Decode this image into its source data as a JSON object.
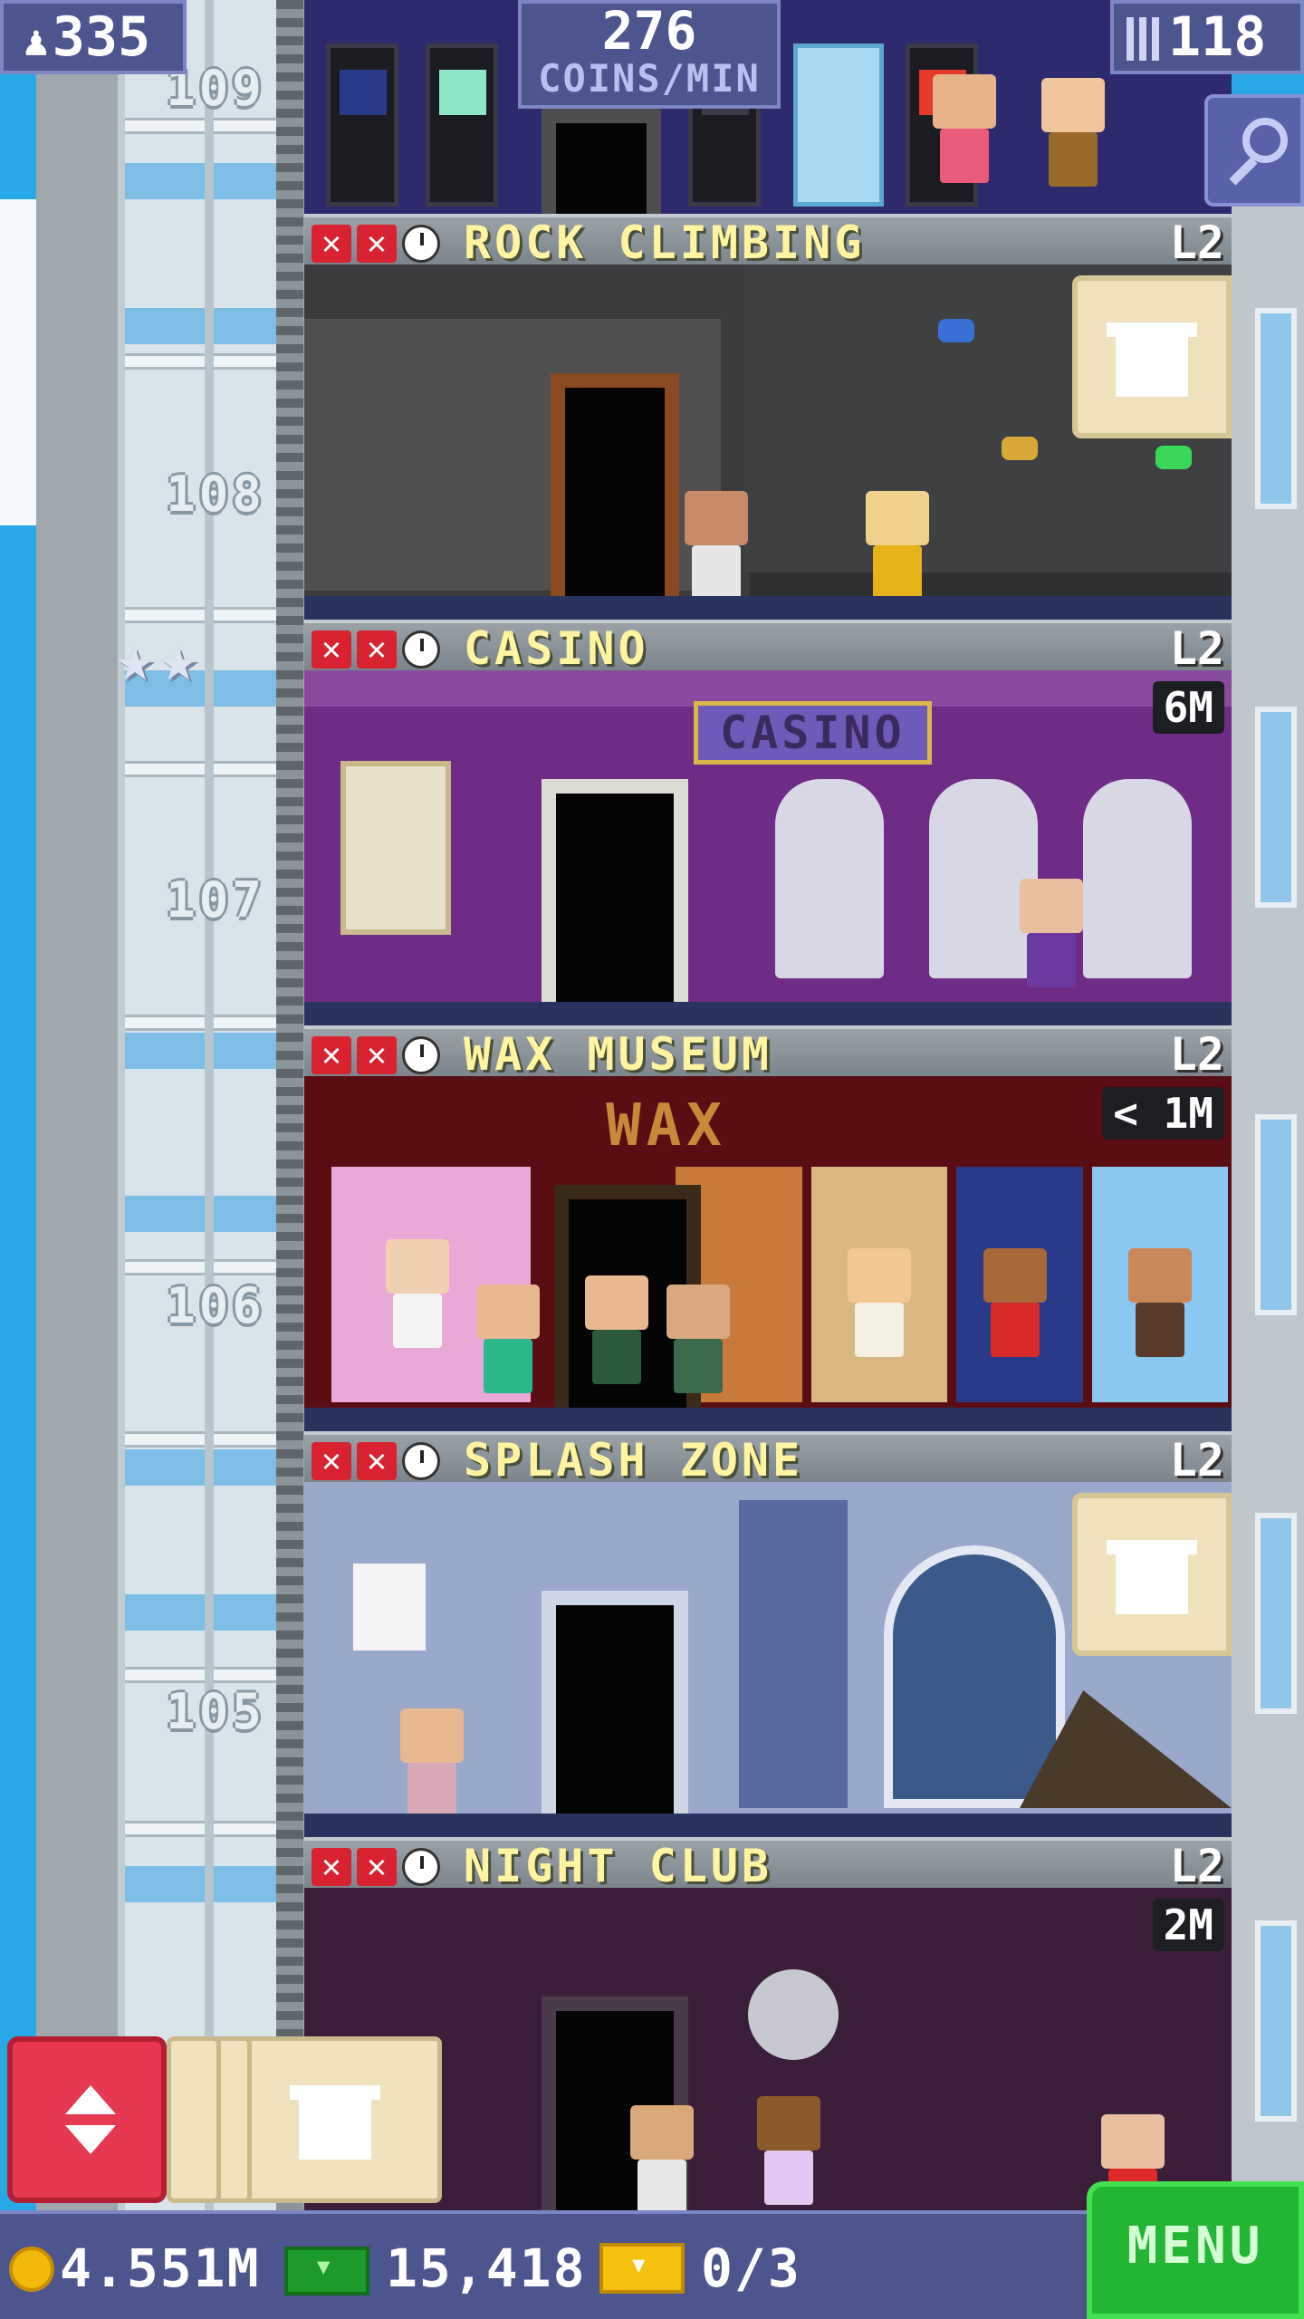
{
  "hud": {
    "population": "335",
    "coins_per_min_value": "276",
    "coins_per_min_unit": "COINS/MIN",
    "floors": "118"
  },
  "floor_numbers": [
    "109",
    "108",
    "107",
    "106",
    "105"
  ],
  "floors": [
    {
      "name": "ROCK CLIMBING",
      "level": "L2",
      "timer": ""
    },
    {
      "name": "CASINO",
      "level": "L2",
      "timer": "6M",
      "sign": "CASINO"
    },
    {
      "name": "WAX MUSEUM",
      "level": "L2",
      "timer": "< 1M",
      "sign": "WAX"
    },
    {
      "name": "SPLASH ZONE",
      "level": "L2",
      "timer": ""
    },
    {
      "name": "NIGHT CLUB",
      "level": "L2",
      "timer": "2M"
    }
  ],
  "bottom": {
    "coins": "4.551M",
    "bux": "15,418",
    "tickets": "0/3",
    "menu_label": "MENU"
  },
  "colors": {
    "hud_bg": "#4c558e",
    "menu_green": "#23b634",
    "elevator_red": "#e63850",
    "floor_name": "#fff5a0"
  }
}
